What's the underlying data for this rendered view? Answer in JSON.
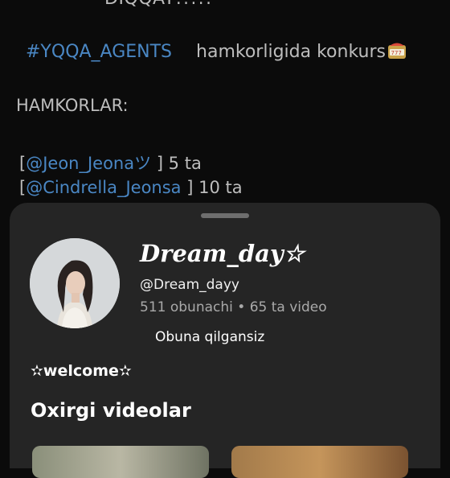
{
  "post": {
    "heading": "DIQQAT!!!!!",
    "hashtag": "#YQQA_AGENTS",
    "contest_text": "hamkorligida konkurs",
    "contest_icon": "slot-machine-icon",
    "partners_title": "HAMKORLAR:",
    "partners": [
      {
        "open": "[",
        "handle": "@Jeon_Jeonaツ",
        "close": "] 5 ta"
      },
      {
        "open": "[",
        "handle": "@Cindrella_Jeonsa",
        "close": "] 10 ta"
      }
    ]
  },
  "channel_sheet": {
    "name": "Dream_day☆",
    "handle": "@Dream_dayy",
    "stats": "511 obunachi • 65 ta video",
    "subscribe_status": "Obuna qilgansiz",
    "description": "✫welcome✫",
    "recent_videos_title": "Oxirgi videolar"
  },
  "colors": {
    "link": "#4a87c4",
    "sheet_bg": "#252525",
    "page_bg": "#0b0b0b"
  }
}
